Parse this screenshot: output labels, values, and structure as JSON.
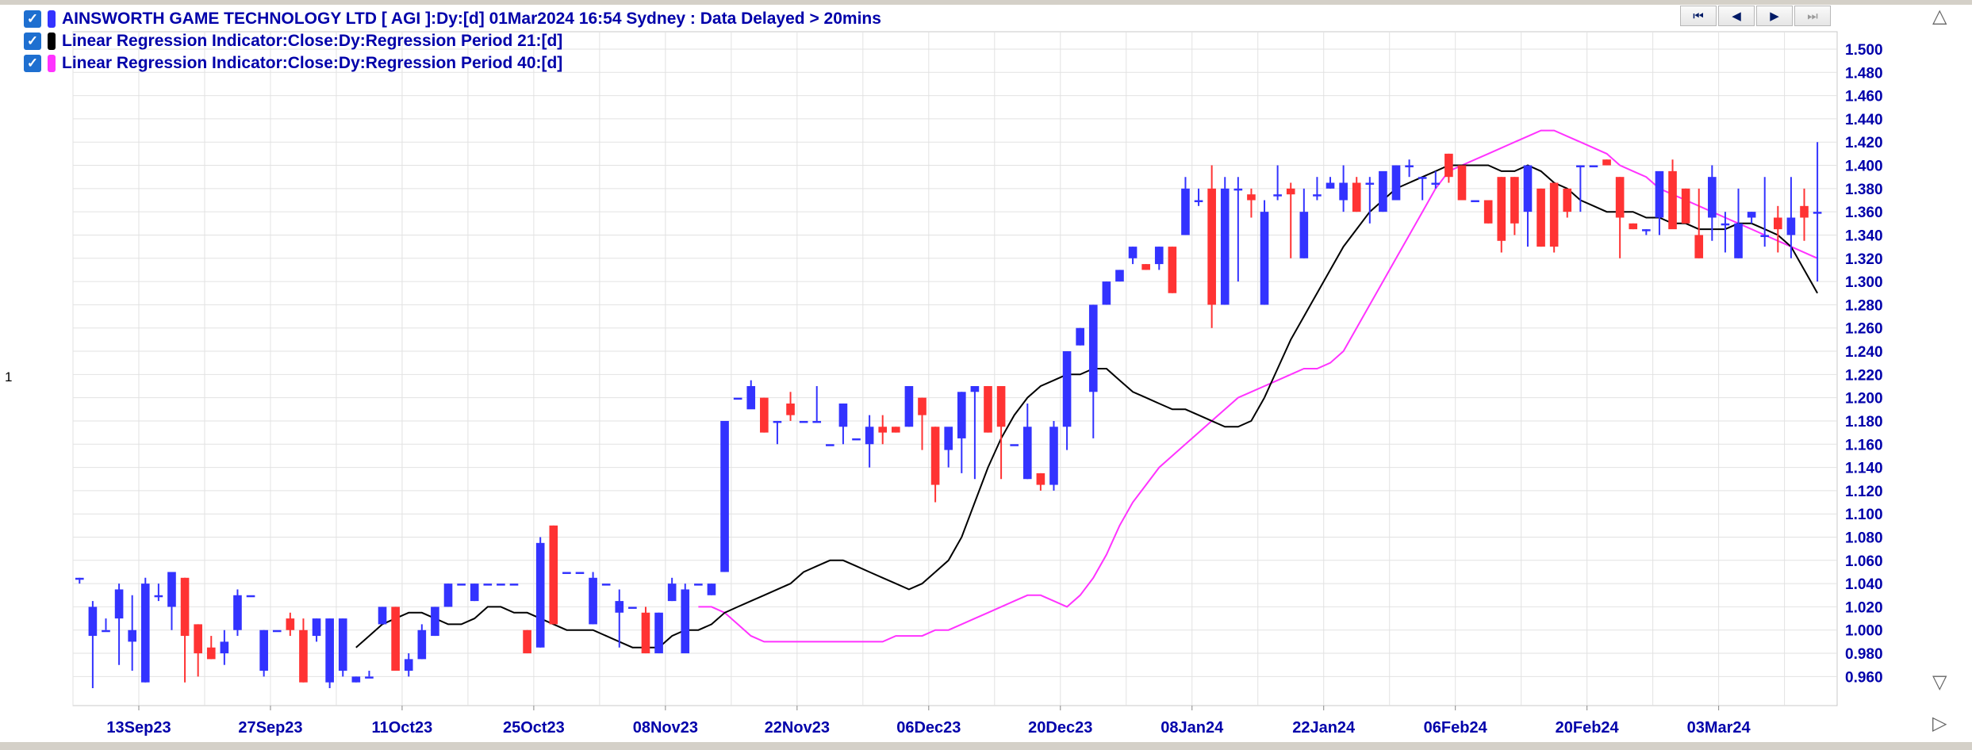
{
  "legend": {
    "main": "AINSWORTH GAME TECHNOLOGY LTD [ AGI ]:Dy:[d]  01Mar2024 16:54 Sydney : Data Delayed > 20mins",
    "lr21": "Linear Regression Indicator:Close:Dy:Regression Period 21:[d]",
    "lr40": "Linear Regression Indicator:Close:Dy:Regression Period 40:[d]",
    "check_glyph": "✓"
  },
  "nav": {
    "first": "⏮",
    "prev": "◀",
    "next": "▶",
    "last": "⏭"
  },
  "side": {
    "up": "△",
    "down": "▽",
    "right": "▷"
  },
  "pane_number": "1",
  "colors": {
    "up": "#3333ff",
    "down": "#ff3333",
    "lr21": "#000000",
    "lr40": "#ff33ff",
    "grid": "#e2e2e2",
    "axis_text": "#0000aa",
    "check": "#1e6fd0",
    "main_swatch": "#3333ff"
  },
  "chart_data": {
    "type": "candlestick",
    "title": "AINSWORTH GAME TECHNOLOGY LTD [ AGI ]:Dy:[d]  01Mar2024 16:54 Sydney : Data Delayed > 20mins",
    "ylim": [
      0.935,
      1.515
    ],
    "y_ticks": [
      "0.960",
      "0.980",
      "1.000",
      "1.020",
      "1.040",
      "1.060",
      "1.080",
      "1.100",
      "1.120",
      "1.140",
      "1.160",
      "1.180",
      "1.200",
      "1.220",
      "1.240",
      "1.260",
      "1.280",
      "1.300",
      "1.320",
      "1.340",
      "1.360",
      "1.380",
      "1.400",
      "1.420",
      "1.440",
      "1.460",
      "1.480",
      "1.500"
    ],
    "x_labels": [
      {
        "label": "13Sep23",
        "index": 4.5
      },
      {
        "label": "27Sep23",
        "index": 14.5
      },
      {
        "label": "11Oct23",
        "index": 24.5
      },
      {
        "label": "25Oct23",
        "index": 34.5
      },
      {
        "label": "08Nov23",
        "index": 44.5
      },
      {
        "label": "22Nov23",
        "index": 54.5
      },
      {
        "label": "06Dec23",
        "index": 64.5
      },
      {
        "label": "20Dec23",
        "index": 74.5
      },
      {
        "label": "08Jan24",
        "index": 84.5
      },
      {
        "label": "22Jan24",
        "index": 94.5
      },
      {
        "label": "06Feb24",
        "index": 104.5
      },
      {
        "label": "20Feb24",
        "index": 114.5
      },
      {
        "label": "03Mar24",
        "index": 124.5
      }
    ],
    "grid": true,
    "series": [
      {
        "name": "AINSWORTH GAME TECHNOLOGY LTD [ AGI ]",
        "ohlc": [
          [
            1.045,
            1.045,
            1.04,
            1.045
          ],
          [
            0.995,
            1.025,
            0.95,
            1.02
          ],
          [
            1.0,
            1.01,
            1.0,
            1.0
          ],
          [
            1.01,
            1.04,
            0.97,
            1.035
          ],
          [
            0.99,
            1.03,
            0.965,
            1.0
          ],
          [
            0.955,
            1.045,
            0.955,
            1.04
          ],
          [
            1.03,
            1.04,
            1.025,
            1.03
          ],
          [
            1.02,
            1.05,
            1.0,
            1.05
          ],
          [
            1.045,
            1.045,
            0.955,
            0.995
          ],
          [
            1.005,
            1.005,
            0.96,
            0.98
          ],
          [
            0.985,
            0.995,
            0.975,
            0.975
          ],
          [
            0.98,
            1.0,
            0.97,
            0.99
          ],
          [
            1.0,
            1.035,
            0.995,
            1.03
          ],
          [
            1.03,
            1.03,
            1.03,
            1.03
          ],
          [
            0.965,
            1.0,
            0.96,
            1.0
          ],
          [
            1.0,
            1.0,
            1.0,
            1.0
          ],
          [
            1.01,
            1.015,
            0.995,
            1.0
          ],
          [
            1.0,
            1.01,
            0.955,
            0.955
          ],
          [
            0.995,
            1.01,
            0.99,
            1.01
          ],
          [
            0.955,
            1.01,
            0.95,
            1.01
          ],
          [
            0.965,
            1.01,
            0.96,
            1.01
          ],
          [
            0.955,
            0.96,
            0.955,
            0.96
          ],
          [
            0.96,
            0.965,
            0.96,
            0.96
          ],
          [
            1.005,
            1.02,
            1.005,
            1.02
          ],
          [
            1.02,
            1.02,
            0.965,
            0.965
          ],
          [
            0.965,
            0.98,
            0.96,
            0.975
          ],
          [
            0.975,
            1.005,
            0.975,
            1.0
          ],
          [
            0.995,
            1.02,
            0.995,
            1.02
          ],
          [
            1.02,
            1.04,
            1.02,
            1.04
          ],
          [
            1.04,
            1.04,
            1.04,
            1.04
          ],
          [
            1.025,
            1.04,
            1.025,
            1.04
          ],
          [
            1.04,
            1.04,
            1.04,
            1.04
          ],
          [
            1.04,
            1.04,
            1.04,
            1.04
          ],
          [
            1.04,
            1.04,
            1.04,
            1.04
          ],
          [
            1.0,
            1.0,
            0.98,
            0.98
          ],
          [
            0.985,
            1.08,
            0.985,
            1.075
          ],
          [
            1.09,
            1.09,
            1.005,
            1.005
          ],
          [
            1.05,
            1.05,
            1.05,
            1.05
          ],
          [
            1.05,
            1.05,
            1.05,
            1.05
          ],
          [
            1.005,
            1.05,
            1.005,
            1.045
          ],
          [
            1.04,
            1.04,
            1.04,
            1.04
          ],
          [
            1.015,
            1.035,
            0.985,
            1.025
          ],
          [
            1.02,
            1.02,
            1.02,
            1.02
          ],
          [
            1.015,
            1.02,
            0.98,
            0.98
          ],
          [
            0.98,
            1.015,
            0.98,
            1.015
          ],
          [
            1.025,
            1.045,
            1.025,
            1.04
          ],
          [
            0.98,
            1.04,
            0.98,
            1.035
          ],
          [
            1.04,
            1.04,
            1.04,
            1.04
          ],
          [
            1.03,
            1.04,
            1.03,
            1.04
          ],
          [
            1.05,
            1.18,
            1.05,
            1.18
          ],
          [
            1.2,
            1.2,
            1.2,
            1.2
          ],
          [
            1.19,
            1.215,
            1.2,
            1.21
          ],
          [
            1.2,
            1.2,
            1.17,
            1.17
          ],
          [
            1.18,
            1.18,
            1.16,
            1.18
          ],
          [
            1.195,
            1.205,
            1.18,
            1.185
          ],
          [
            1.18,
            1.18,
            1.18,
            1.18
          ],
          [
            1.18,
            1.21,
            1.18,
            1.18
          ],
          [
            1.16,
            1.16,
            1.16,
            1.16
          ],
          [
            1.175,
            1.195,
            1.16,
            1.195
          ],
          [
            1.165,
            1.165,
            1.165,
            1.165
          ],
          [
            1.16,
            1.185,
            1.14,
            1.175
          ],
          [
            1.175,
            1.185,
            1.16,
            1.17
          ],
          [
            1.175,
            1.175,
            1.17,
            1.17
          ],
          [
            1.175,
            1.21,
            1.175,
            1.21
          ],
          [
            1.2,
            1.2,
            1.155,
            1.185
          ],
          [
            1.175,
            1.175,
            1.11,
            1.125
          ],
          [
            1.155,
            1.16,
            1.14,
            1.175
          ],
          [
            1.165,
            1.205,
            1.135,
            1.205
          ],
          [
            1.205,
            1.21,
            1.13,
            1.21
          ],
          [
            1.21,
            1.21,
            1.17,
            1.17
          ],
          [
            1.21,
            1.21,
            1.13,
            1.175
          ],
          [
            1.16,
            1.16,
            1.16,
            1.16
          ],
          [
            1.13,
            1.195,
            1.13,
            1.175
          ],
          [
            1.135,
            1.135,
            1.12,
            1.125
          ],
          [
            1.125,
            1.18,
            1.12,
            1.175
          ],
          [
            1.175,
            1.24,
            1.155,
            1.24
          ],
          [
            1.245,
            1.26,
            1.245,
            1.26
          ],
          [
            1.205,
            1.28,
            1.165,
            1.28
          ],
          [
            1.28,
            1.3,
            1.28,
            1.3
          ],
          [
            1.3,
            1.31,
            1.3,
            1.31
          ],
          [
            1.32,
            1.33,
            1.315,
            1.33
          ],
          [
            1.315,
            1.315,
            1.31,
            1.31
          ],
          [
            1.315,
            1.33,
            1.31,
            1.33
          ],
          [
            1.33,
            1.33,
            1.29,
            1.29
          ],
          [
            1.34,
            1.39,
            1.34,
            1.38
          ],
          [
            1.37,
            1.38,
            1.365,
            1.37
          ],
          [
            1.38,
            1.4,
            1.26,
            1.28
          ],
          [
            1.28,
            1.39,
            1.28,
            1.38
          ],
          [
            1.38,
            1.39,
            1.3,
            1.38
          ],
          [
            1.375,
            1.38,
            1.355,
            1.37
          ],
          [
            1.28,
            1.37,
            1.28,
            1.36
          ],
          [
            1.375,
            1.4,
            1.37,
            1.375
          ],
          [
            1.38,
            1.385,
            1.32,
            1.375
          ],
          [
            1.32,
            1.38,
            1.32,
            1.36
          ],
          [
            1.375,
            1.39,
            1.37,
            1.375
          ],
          [
            1.38,
            1.39,
            1.38,
            1.385
          ],
          [
            1.37,
            1.4,
            1.36,
            1.385
          ],
          [
            1.385,
            1.39,
            1.36,
            1.36
          ],
          [
            1.385,
            1.39,
            1.35,
            1.385
          ],
          [
            1.36,
            1.39,
            1.36,
            1.395
          ],
          [
            1.37,
            1.4,
            1.37,
            1.4
          ],
          [
            1.4,
            1.405,
            1.39,
            1.4
          ],
          [
            1.39,
            1.39,
            1.37,
            1.39
          ],
          [
            1.385,
            1.395,
            1.38,
            1.385
          ],
          [
            1.41,
            1.41,
            1.385,
            1.39
          ],
          [
            1.4,
            1.4,
            1.37,
            1.37
          ],
          [
            1.37,
            1.37,
            1.37,
            1.37
          ],
          [
            1.37,
            1.37,
            1.35,
            1.35
          ],
          [
            1.39,
            1.39,
            1.325,
            1.335
          ],
          [
            1.39,
            1.39,
            1.34,
            1.35
          ],
          [
            1.36,
            1.4,
            1.33,
            1.4
          ],
          [
            1.38,
            1.38,
            1.33,
            1.33
          ],
          [
            1.385,
            1.385,
            1.325,
            1.33
          ],
          [
            1.38,
            1.38,
            1.355,
            1.36
          ],
          [
            1.4,
            1.4,
            1.36,
            1.4
          ],
          [
            1.4,
            1.4,
            1.4,
            1.4
          ],
          [
            1.405,
            1.405,
            1.4,
            1.4
          ],
          [
            1.39,
            1.39,
            1.32,
            1.355
          ],
          [
            1.35,
            1.35,
            1.345,
            1.345
          ],
          [
            1.345,
            1.345,
            1.34,
            1.345
          ],
          [
            1.355,
            1.39,
            1.34,
            1.395
          ],
          [
            1.395,
            1.405,
            1.35,
            1.345
          ],
          [
            1.38,
            1.38,
            1.35,
            1.35
          ],
          [
            1.34,
            1.38,
            1.32,
            1.32
          ],
          [
            1.355,
            1.4,
            1.335,
            1.39
          ],
          [
            1.35,
            1.36,
            1.325,
            1.35
          ],
          [
            1.32,
            1.38,
            1.32,
            1.35
          ],
          [
            1.355,
            1.36,
            1.35,
            1.36
          ],
          [
            1.34,
            1.39,
            1.33,
            1.34
          ],
          [
            1.355,
            1.365,
            1.325,
            1.345
          ],
          [
            1.34,
            1.39,
            1.32,
            1.355
          ],
          [
            1.365,
            1.38,
            1.335,
            1.355
          ],
          [
            1.36,
            1.42,
            1.3,
            1.36
          ]
        ]
      },
      {
        "name": "Linear Regression Indicator:Close:Dy:Regression Period 21:[d]",
        "values": [
          0.985,
          0.995,
          1.005,
          1.01,
          1.015,
          1.015,
          1.01,
          1.005,
          1.005,
          1.01,
          1.02,
          1.02,
          1.015,
          1.015,
          1.01,
          1.005,
          1.0,
          1.0,
          1.0,
          0.995,
          0.99,
          0.985,
          0.985,
          0.985,
          0.995,
          1.0,
          1.0,
          1.005,
          1.015,
          1.02,
          1.025,
          1.03,
          1.035,
          1.04,
          1.05,
          1.055,
          1.06,
          1.06,
          1.055,
          1.05,
          1.045,
          1.04,
          1.035,
          1.04,
          1.05,
          1.06,
          1.08,
          1.11,
          1.14,
          1.165,
          1.185,
          1.2,
          1.21,
          1.215,
          1.22,
          1.22,
          1.225,
          1.225,
          1.215,
          1.205,
          1.2,
          1.195,
          1.19,
          1.19,
          1.185,
          1.18,
          1.175,
          1.175,
          1.18,
          1.2,
          1.225,
          1.25,
          1.27,
          1.29,
          1.31,
          1.33,
          1.345,
          1.36,
          1.37,
          1.38,
          1.385,
          1.39,
          1.395,
          1.4,
          1.4,
          1.4,
          1.4,
          1.395,
          1.395,
          1.4,
          1.395,
          1.385,
          1.38,
          1.37,
          1.365,
          1.36,
          1.36,
          1.36,
          1.355,
          1.355,
          1.35,
          1.35,
          1.345,
          1.345,
          1.345,
          1.35,
          1.35,
          1.345,
          1.34,
          1.33,
          1.31,
          1.29
        ]
      },
      {
        "name": "Linear Regression Indicator:Close:Dy:Regression Period 40:[d]",
        "values": [
          1.02,
          1.02,
          1.015,
          1.005,
          0.995,
          0.99,
          0.99,
          0.99,
          0.99,
          0.99,
          0.99,
          0.99,
          0.99,
          0.99,
          0.99,
          0.995,
          0.995,
          0.995,
          1.0,
          1.0,
          1.005,
          1.01,
          1.015,
          1.02,
          1.025,
          1.03,
          1.03,
          1.025,
          1.02,
          1.03,
          1.045,
          1.065,
          1.09,
          1.11,
          1.125,
          1.14,
          1.15,
          1.16,
          1.17,
          1.18,
          1.19,
          1.2,
          1.205,
          1.21,
          1.215,
          1.22,
          1.225,
          1.225,
          1.23,
          1.24,
          1.26,
          1.28,
          1.3,
          1.32,
          1.34,
          1.36,
          1.38,
          1.395,
          1.4,
          1.405,
          1.41,
          1.415,
          1.42,
          1.425,
          1.43,
          1.43,
          1.425,
          1.42,
          1.415,
          1.41,
          1.4,
          1.395,
          1.39,
          1.38,
          1.375,
          1.37,
          1.365,
          1.36,
          1.355,
          1.35,
          1.345,
          1.34,
          1.335,
          1.33,
          1.325,
          1.32
        ]
      }
    ]
  }
}
